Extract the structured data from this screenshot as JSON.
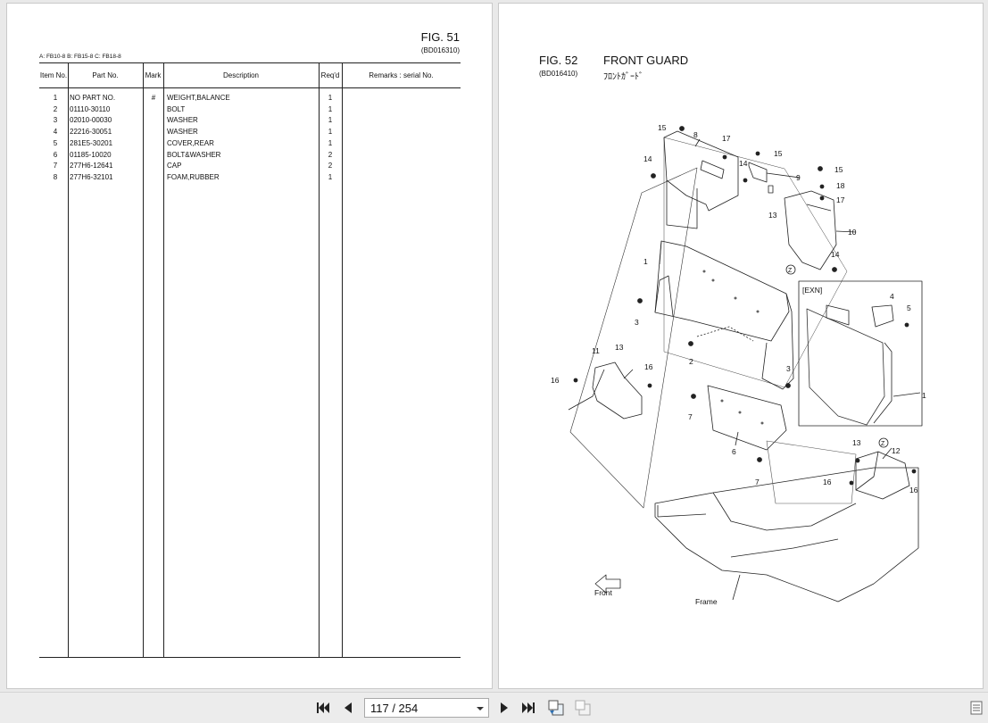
{
  "left_page": {
    "fig_title": "FIG. 51",
    "fig_code": "(BD016310)",
    "models": "A: FB10-8   B: FB15-8   C: FB18-8",
    "columns": {
      "item_no": "Item No.",
      "part_no": "Part No.",
      "mark": "Mark",
      "description": "Description",
      "reqd": "Req'd",
      "remarks": "Remarks : serial No."
    },
    "rows": [
      {
        "item": "1",
        "part": "NO PART NO.",
        "mark": "#",
        "desc": "WEIGHT,BALANCE",
        "req": "1"
      },
      {
        "item": "2",
        "part": "01110-30110",
        "mark": "",
        "desc": "BOLT",
        "req": "1"
      },
      {
        "item": "3",
        "part": "02010-00030",
        "mark": "",
        "desc": "WASHER",
        "req": "1"
      },
      {
        "item": "4",
        "part": "22216-30051",
        "mark": "",
        "desc": "WASHER",
        "req": "1"
      },
      {
        "item": "5",
        "part": "281E5-30201",
        "mark": "",
        "desc": "COVER,REAR",
        "req": "1"
      },
      {
        "item": "6",
        "part": "01185-10020",
        "mark": "",
        "desc": "BOLT&WASHER",
        "req": "2"
      },
      {
        "item": "7",
        "part": "277H6-12641",
        "mark": "",
        "desc": "CAP",
        "req": "2"
      },
      {
        "item": "8",
        "part": "277H6-32101",
        "mark": "",
        "desc": "FOAM,RUBBER",
        "req": "1"
      }
    ]
  },
  "right_page": {
    "fig_title": "FIG. 52",
    "fig_name": "FRONT GUARD",
    "fig_code": "(BD016410)",
    "fig_name_jp": "ﾌﾛﾝﾄｶﾞｰﾄﾞ",
    "inset_label": "[EXN]",
    "frame_label": "Frame",
    "front_label": "Front",
    "zone_label": "Z",
    "callouts": {
      "n1": "1",
      "n2": "2",
      "n3": "3",
      "n4": "4",
      "n5": "5",
      "n6": "6",
      "n7": "7",
      "n8": "8",
      "n9": "9",
      "n10": "10",
      "n11": "11",
      "n12": "12",
      "n13": "13",
      "n14": "14",
      "n15": "15",
      "n16": "16",
      "n17": "17",
      "n18": "18"
    }
  },
  "toolbar": {
    "page_indicator": "117 / 254",
    "icons": {
      "first": "first-page-icon",
      "prev": "previous-page-icon",
      "next": "next-page-icon",
      "last": "last-page-icon",
      "single": "single-page-view-icon",
      "facing": "facing-pages-view-icon",
      "menu": "menu-icon"
    }
  }
}
